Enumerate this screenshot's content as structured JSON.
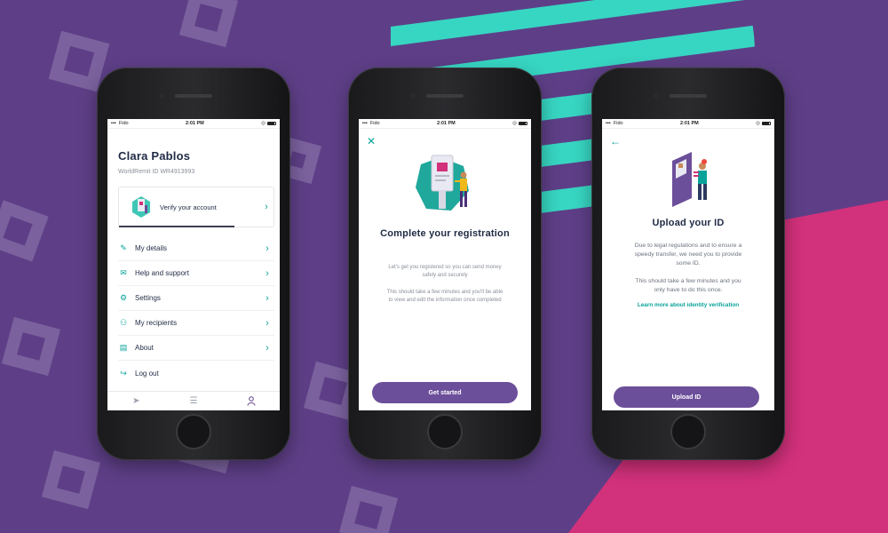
{
  "status_bar": {
    "carrier": "Fido",
    "time": "2:01 PM"
  },
  "profile_screen": {
    "name": "Clara Pablos",
    "worldremit_id": "WorldRemit ID WR4913993",
    "verify_label": "Verify your account",
    "menu": [
      {
        "label": "My details",
        "icon": "edit-icon"
      },
      {
        "label": "Help and support",
        "icon": "mail-icon"
      },
      {
        "label": "Settings",
        "icon": "gear-icon"
      },
      {
        "label": "My recipients",
        "icon": "people-icon"
      },
      {
        "label": "About",
        "icon": "document-icon"
      },
      {
        "label": "Log out",
        "icon": "logout-icon"
      }
    ],
    "tabs": [
      "send-icon",
      "transactions-icon",
      "account-icon"
    ]
  },
  "registration_screen": {
    "title": "Complete your registration",
    "para1_line1": "Let's get you registered so you can send money",
    "para1_line2": "safely and securely",
    "para2_line1": "This should take a few minutes and you'll be able",
    "para2_line2": "to view and edit the information once completed",
    "cta": "Get started"
  },
  "upload_screen": {
    "title": "Upload your ID",
    "para1_line1": "Due to legal regulations and to ensure a",
    "para1_line2": "speedy transfer, we need you to provide",
    "para1_line3": "some ID.",
    "para2_line1": "This should take a few minutes and you",
    "para2_line2": "only have to do this once.",
    "link": "Learn more about identity verification",
    "cta": "Upload ID"
  },
  "colors": {
    "brand_purple": "#5e3f87",
    "teal": "#0aa39a",
    "pink": "#d2317b",
    "button_purple": "#6c4f9a"
  }
}
